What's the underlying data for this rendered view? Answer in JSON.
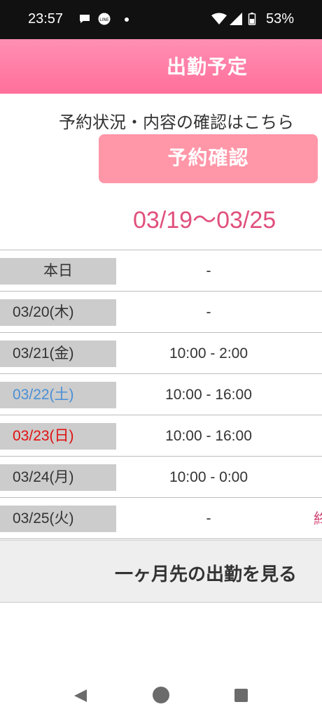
{
  "status_bar": {
    "time": "23:57",
    "battery": "53%",
    "left_icons": [
      "chat-bubble-icon",
      "line-app-icon",
      "dot-icon"
    ],
    "right_icons": [
      "wifi-icon",
      "signal-icon",
      "battery-icon"
    ]
  },
  "header": {
    "title": "出勤予定"
  },
  "notice": {
    "text": "予約状況・内容の確認はこちら"
  },
  "reserve_button": {
    "label": "予約確認"
  },
  "date_range": "03/19～03/25",
  "schedule": [
    {
      "date": "本日",
      "time": "-",
      "date_color": "#333333"
    },
    {
      "date": "03/20(木)",
      "time": "-",
      "date_color": "#333333"
    },
    {
      "date": "03/21(金)",
      "time": "10:00 - 2:00",
      "date_color": "#333333"
    },
    {
      "date": "03/22(土)",
      "time": "10:00 - 16:00",
      "date_color": "#4a8fd6"
    },
    {
      "date": "03/23(日)",
      "time": "10:00 - 16:00",
      "date_color": "#e01010"
    },
    {
      "date": "03/24(月)",
      "time": "10:00 - 0:00",
      "date_color": "#333333"
    },
    {
      "date": "03/25(火)",
      "time": "-",
      "date_color": "#333333",
      "extra": "終"
    }
  ],
  "month_button": {
    "label": "一ヶ月先の出勤を見る"
  },
  "nav_bar": {
    "icons": [
      "back-icon",
      "home-icon",
      "recents-icon"
    ]
  },
  "colors": {
    "accent": "#ff6f9a",
    "button": "#ff97a8",
    "date_range": "#e0507c"
  }
}
